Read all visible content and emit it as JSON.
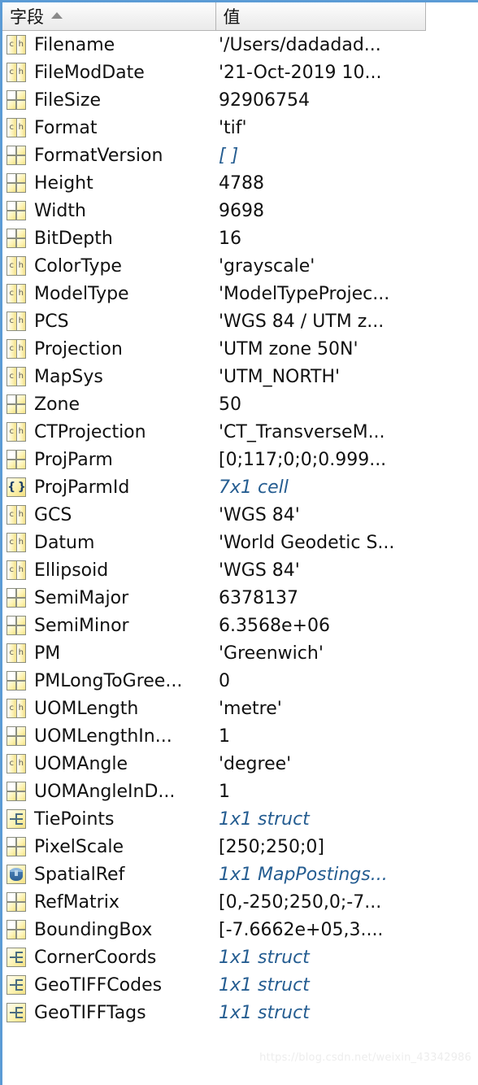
{
  "panel": {
    "type": "matlab-variable-inspector",
    "accent_color": "#5b9bd5",
    "italic_value_color": "#255d91"
  },
  "header": {
    "field_label": "字段",
    "value_label": "值",
    "sort_direction": "ascending",
    "sort_icon": "triangle-up-icon"
  },
  "rows": [
    {
      "icon": "char-icon",
      "name": "Filename",
      "value": "'/Users/dadadad...",
      "italic": false
    },
    {
      "icon": "char-icon",
      "name": "FileModDate",
      "value": "'21-Oct-2019 10...",
      "italic": false
    },
    {
      "icon": "matrix-icon",
      "name": "FileSize",
      "value": "92906754",
      "italic": false
    },
    {
      "icon": "char-icon",
      "name": "Format",
      "value": "'tif'",
      "italic": false
    },
    {
      "icon": "matrix-icon",
      "name": "FormatVersion",
      "value": "[ ]",
      "italic": true
    },
    {
      "icon": "matrix-icon",
      "name": "Height",
      "value": "4788",
      "italic": false
    },
    {
      "icon": "matrix-icon",
      "name": "Width",
      "value": "9698",
      "italic": false
    },
    {
      "icon": "matrix-icon",
      "name": "BitDepth",
      "value": "16",
      "italic": false
    },
    {
      "icon": "char-icon",
      "name": "ColorType",
      "value": "'grayscale'",
      "italic": false
    },
    {
      "icon": "char-icon",
      "name": "ModelType",
      "value": "'ModelTypeProjec...",
      "italic": false
    },
    {
      "icon": "char-icon",
      "name": "PCS",
      "value": "'WGS 84 / UTM z...",
      "italic": false
    },
    {
      "icon": "char-icon",
      "name": "Projection",
      "value": "'UTM zone 50N'",
      "italic": false
    },
    {
      "icon": "char-icon",
      "name": "MapSys",
      "value": "'UTM_NORTH'",
      "italic": false
    },
    {
      "icon": "matrix-icon",
      "name": "Zone",
      "value": "50",
      "italic": false
    },
    {
      "icon": "char-icon",
      "name": "CTProjection",
      "value": "'CT_TransverseM...",
      "italic": false
    },
    {
      "icon": "matrix-icon",
      "name": "ProjParm",
      "value": "[0;117;0;0;0.999...",
      "italic": false
    },
    {
      "icon": "cell-icon",
      "name": "ProjParmId",
      "value": "7x1 cell",
      "italic": true
    },
    {
      "icon": "char-icon",
      "name": "GCS",
      "value": "'WGS 84'",
      "italic": false
    },
    {
      "icon": "char-icon",
      "name": "Datum",
      "value": "'World Geodetic S...",
      "italic": false
    },
    {
      "icon": "char-icon",
      "name": "Ellipsoid",
      "value": "'WGS 84'",
      "italic": false
    },
    {
      "icon": "matrix-icon",
      "name": "SemiMajor",
      "value": "6378137",
      "italic": false
    },
    {
      "icon": "matrix-icon",
      "name": "SemiMinor",
      "value": "6.3568e+06",
      "italic": false
    },
    {
      "icon": "char-icon",
      "name": "PM",
      "value": "'Greenwich'",
      "italic": false
    },
    {
      "icon": "matrix-icon",
      "name": "PMLongToGree...",
      "value": "0",
      "italic": false
    },
    {
      "icon": "char-icon",
      "name": "UOMLength",
      "value": "'metre'",
      "italic": false
    },
    {
      "icon": "matrix-icon",
      "name": "UOMLengthIn...",
      "value": "1",
      "italic": false
    },
    {
      "icon": "char-icon",
      "name": "UOMAngle",
      "value": "'degree'",
      "italic": false
    },
    {
      "icon": "matrix-icon",
      "name": "UOMAngleInD...",
      "value": "1",
      "italic": false
    },
    {
      "icon": "struct-icon",
      "name": "TiePoints",
      "value": "1x1 struct",
      "italic": true
    },
    {
      "icon": "matrix-icon",
      "name": "PixelScale",
      "value": "[250;250;0]",
      "italic": false
    },
    {
      "icon": "object-icon",
      "name": "SpatialRef",
      "value": "1x1 MapPostings...",
      "italic": true
    },
    {
      "icon": "matrix-icon",
      "name": "RefMatrix",
      "value": "[0,-250;250,0;-7...",
      "italic": false
    },
    {
      "icon": "matrix-icon",
      "name": "BoundingBox",
      "value": "[-7.6662e+05,3....",
      "italic": false
    },
    {
      "icon": "struct-icon",
      "name": "CornerCoords",
      "value": "1x1 struct",
      "italic": true
    },
    {
      "icon": "struct-icon",
      "name": "GeoTIFFCodes",
      "value": "1x1 struct",
      "italic": true
    },
    {
      "icon": "struct-icon",
      "name": "GeoTIFFTags",
      "value": "1x1 struct",
      "italic": true
    }
  ],
  "watermark": {
    "text": "https://blog.csdn.net/weixin_43342986"
  }
}
